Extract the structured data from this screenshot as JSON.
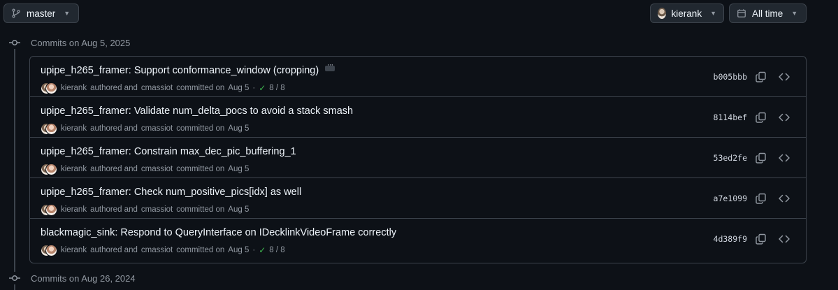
{
  "toolbar": {
    "branch": "master",
    "user": "kierank",
    "time_filter": "All time"
  },
  "groups": [
    {
      "header": "Commits on Aug 5, 2025"
    },
    {
      "header": "Commits on Aug 26, 2024"
    }
  ],
  "commits": [
    {
      "title": "upipe_h265_framer: Support conformance_window (cropping)",
      "author": "kierank",
      "committer": "cmassiot",
      "date": "Aug 5",
      "checks": "8 / 8",
      "sha": "b005bbb",
      "ellipsis": true
    },
    {
      "title": "upipe_h265_framer: Validate num_delta_pocs to avoid a stack smash",
      "author": "kierank",
      "committer": "cmassiot",
      "date": "Aug 5",
      "checks": "",
      "sha": "8114bef",
      "ellipsis": false
    },
    {
      "title": "upipe_h265_framer: Constrain max_dec_pic_buffering_1",
      "author": "kierank",
      "committer": "cmassiot",
      "date": "Aug 5",
      "checks": "",
      "sha": "53ed2fe",
      "ellipsis": false
    },
    {
      "title": "upipe_h265_framer: Check num_positive_pics[idx] as well",
      "author": "kierank",
      "committer": "cmassiot",
      "date": "Aug 5",
      "checks": "",
      "sha": "a7e1099",
      "ellipsis": false
    },
    {
      "title": "blackmagic_sink: Respond to QueryInterface on IDecklinkVideoFrame correctly",
      "author": "kierank",
      "committer": "cmassiot",
      "date": "Aug 5",
      "checks": "8 / 8",
      "sha": "4d389f9",
      "ellipsis": false
    }
  ],
  "labels": {
    "authored": "authored and",
    "committed": "committed on",
    "dot": "·"
  },
  "colors": {
    "background": "#0d1117",
    "border": "#3d444d",
    "success": "#3fb950"
  }
}
